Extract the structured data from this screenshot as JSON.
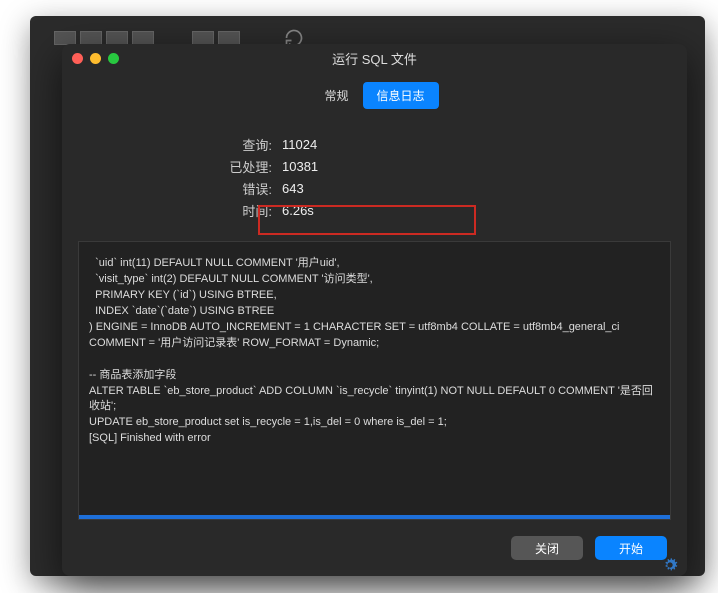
{
  "dialog": {
    "title": "运行 SQL 文件",
    "tabs": {
      "general": "常规",
      "log": "信息日志"
    },
    "stats": {
      "queries_label": "查询:",
      "queries_value": "11024",
      "processed_label": "已处理:",
      "processed_value": "10381",
      "errors_label": "错误:",
      "errors_value": "643",
      "time_label": "时间:",
      "time_value": "6.26s"
    },
    "log_text": "  `uid` int(11) DEFAULT NULL COMMENT '用户uid',\n  `visit_type` int(2) DEFAULT NULL COMMENT '访问类型',\n  PRIMARY KEY (`id`) USING BTREE,\n  INDEX `date`(`date`) USING BTREE\n) ENGINE = InnoDB AUTO_INCREMENT = 1 CHARACTER SET = utf8mb4 COLLATE = utf8mb4_general_ci COMMENT = '用户访问记录表' ROW_FORMAT = Dynamic;\n\n-- 商品表添加字段\nALTER TABLE `eb_store_product` ADD COLUMN `is_recycle` tinyint(1) NOT NULL DEFAULT 0 COMMENT '是否回收站';\nUPDATE eb_store_product set is_recycle = 1,is_del = 0 where is_del = 1;\n[SQL] Finished with error",
    "buttons": {
      "close": "关闭",
      "start": "开始"
    }
  }
}
